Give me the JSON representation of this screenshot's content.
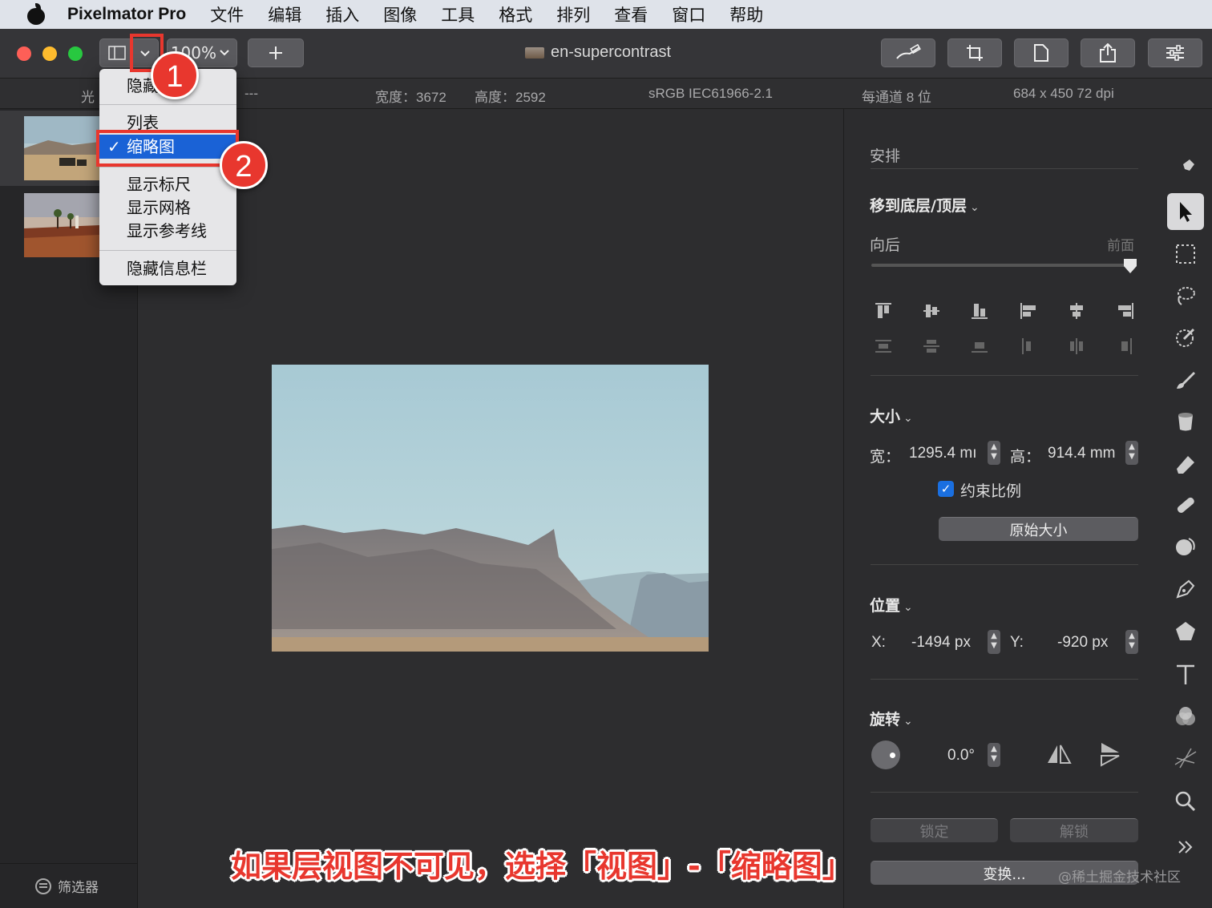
{
  "menubar": {
    "app_name": "Pixelmator Pro",
    "items": [
      "文件",
      "编辑",
      "插入",
      "图像",
      "工具",
      "格式",
      "排列",
      "查看",
      "窗口",
      "帮助"
    ]
  },
  "toolbar": {
    "zoom_value": "100%",
    "doc_title": "en-supercontrast"
  },
  "infobar": {
    "left_label_partial": "光",
    "dash": "---",
    "width": "宽度：3672",
    "height": "高度：2592",
    "color_profile": "sRGB IEC61966-2.1",
    "bit_depth": "每通道 8 位",
    "resolution": "684 x 450 72 dpi"
  },
  "dropdown": {
    "hide_partial": "隐藏",
    "list": "列表",
    "thumbnails": "缩略图",
    "checkmark": "✓",
    "show_rulers": "显示标尺",
    "show_grid": "显示网格",
    "show_guides": "显示参考线",
    "hide_info_bar": "隐藏信息栏"
  },
  "sidebar": {
    "filter_label": "筛选器"
  },
  "right_panel": {
    "arrange_title": "安排",
    "move_to_bottom_top": "移到底层/顶层",
    "backward": "向后",
    "front": "前面",
    "size_title": "大小",
    "width_label": "宽：",
    "width_value": "1295.4 mı",
    "height_label": "高：",
    "height_value": "914.4 mm",
    "constrain_label": "约束比例",
    "original_size_button": "原始大小",
    "position_title": "位置",
    "x_label": "X:",
    "x_value": "-1494 px",
    "y_label": "Y:",
    "y_value": "-920 px",
    "rotate_title": "旋转",
    "rotate_value": "0.0°",
    "lock_button": "锁定",
    "unlock_button": "解锁",
    "transform_button": "变换...",
    "chevron": "⌄"
  },
  "annotations": {
    "badge_1": "1",
    "badge_2": "2",
    "caption": "如果层视图不可见，选择「视图」-「缩略图」",
    "accent_color": "#e8372e"
  },
  "watermark": "@稀土掘金技术社区"
}
